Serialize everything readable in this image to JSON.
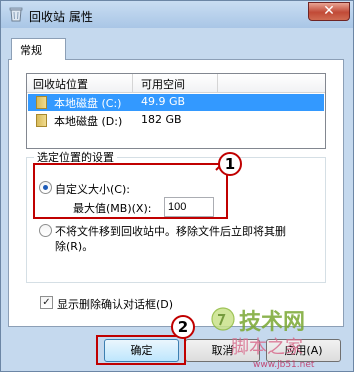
{
  "window": {
    "title": "回收站 属性",
    "close_glyph": "✕"
  },
  "tabs": [
    {
      "label": "常规"
    }
  ],
  "list": {
    "headers": [
      "回收站位置",
      "可用空间"
    ],
    "rows": [
      {
        "location": "本地磁盘 (C:)",
        "space": "49.9 GB",
        "selected": true
      },
      {
        "location": "本地磁盘 (D:)",
        "space": "182 GB",
        "selected": false
      }
    ]
  },
  "settings": {
    "group_label": "选定位置的设置",
    "custom_size_label": "自定义大小(C):",
    "max_value_label": "最大值(MB)(X):",
    "max_value": "100",
    "no_recycle_label_line1": "不将文件移到回收站中。移除文件后立即将其删",
    "no_recycle_label_line2": "除(R)。",
    "confirm_label": "显示删除确认对话框(D)",
    "confirm_checked": "✓"
  },
  "buttons": {
    "ok": "确定",
    "cancel": "取消",
    "apply": "应用(A)"
  },
  "callouts": {
    "one": "1",
    "two": "2"
  },
  "watermark": {
    "line1": "技术网",
    "line2": "脚本之家",
    "line3": "www.jb51.net"
  },
  "colors": {
    "selection": "#3399ff",
    "callout": "#c00000",
    "window_frame": "#c5d9ee"
  }
}
